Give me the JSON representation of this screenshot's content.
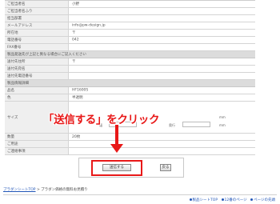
{
  "form": {
    "rows_top": [
      {
        "label": "ご担当者名",
        "value": "小野"
      },
      {
        "label": "ご担当者名ふり",
        "value": ""
      },
      {
        "label": "担当部署",
        "value": ""
      },
      {
        "label": "メールアドレス",
        "value": "info@pw-design.jp"
      },
      {
        "label": "所在地",
        "value": "〒"
      },
      {
        "label": "電話番号",
        "value": "042"
      },
      {
        "label": "FAX番号",
        "value": ""
      }
    ],
    "section_delivery": "製品発送先が上記と異なる場合にご記入ください",
    "rows_delivery": [
      {
        "label": "送付先住所",
        "value": "〒"
      },
      {
        "label": "送付先宛名",
        "value": ""
      },
      {
        "label": "送付先電話番号",
        "value": ""
      }
    ],
    "section_product": "製品情報詳細",
    "rows_product": [
      {
        "label": "品名",
        "value": "HF1600S"
      },
      {
        "label": "色",
        "value": "半透明"
      }
    ],
    "size": {
      "label": "サイズ",
      "unit": "mm",
      "width_label": "幅",
      "depth_label": "奥行"
    },
    "rows_bottom": [
      {
        "label": "数量",
        "value": "20枚"
      },
      {
        "label": "ご用途",
        "value": ""
      },
      {
        "label": "ご連絡事項",
        "value": ""
      }
    ]
  },
  "annotation": {
    "callout_text": "「送信する」をクリック",
    "highlight_color": "#e81818"
  },
  "buttons": {
    "submit_label": "送信する",
    "back_label": "戻る"
  },
  "breadcrumb": {
    "home": "プラダンシートTOP",
    "separator": ">",
    "current": "プラダン価格の無料お見積り"
  },
  "footer_nav": {
    "items": [
      "製品シートTOP",
      "12番のページ",
      "ページの先頭"
    ]
  }
}
